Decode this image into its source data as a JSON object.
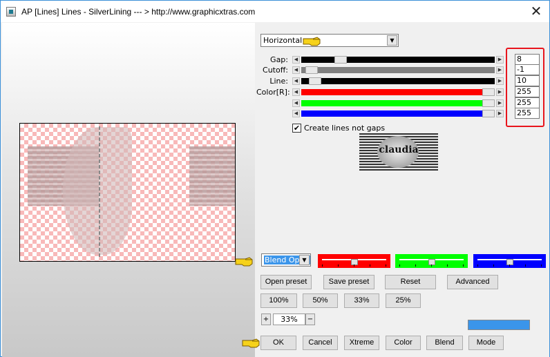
{
  "window": {
    "title": "AP [Lines]  Lines - SilverLining    --- > http://www.graphicxtras.com",
    "close_glyph": "✕"
  },
  "direction": {
    "value": "Horizontal",
    "arrow_glyph": "▼"
  },
  "sliders": [
    {
      "label": "Gap:",
      "value": "8",
      "color": "#000000",
      "fraction": 0.17
    },
    {
      "label": "Cutoff:",
      "value": "-1",
      "color": "#808080",
      "fraction": 0.02
    },
    {
      "label": "Line:",
      "value": "10",
      "color": "#000000",
      "fraction": 0.04
    },
    {
      "label": "Color[R]:",
      "value": "255",
      "color": "#ff0000",
      "fraction": 1.0
    },
    {
      "label": "",
      "value": "255",
      "color": "#00ff00",
      "fraction": 1.0
    },
    {
      "label": "",
      "value": "255",
      "color": "#0000ff",
      "fraction": 1.0
    }
  ],
  "checkbox": {
    "label": "Create lines not gaps",
    "checked": true,
    "mark": "✔"
  },
  "logo": {
    "text": "claudia"
  },
  "blend_select": {
    "value": "Blend Optio",
    "arrow_glyph": "▼"
  },
  "color_bars": [
    {
      "color": "#ff0000",
      "fraction": 0.5
    },
    {
      "color": "#00ff00",
      "fraction": 0.5
    },
    {
      "color": "#0000ff",
      "fraction": 0.5
    }
  ],
  "buttons_row1": [
    "Open preset",
    "Save preset",
    "Reset",
    "Advanced"
  ],
  "zoom_presets": [
    "100%",
    "50%",
    "33%",
    "25%"
  ],
  "zoom": {
    "plus": "+",
    "minus": "−",
    "value": "33%"
  },
  "bottom_buttons": [
    "OK",
    "Cancel",
    "Xtreme",
    "Color",
    "Blend",
    "Mode"
  ],
  "accent_color": "#3b95ea",
  "highlight_color": "#e8141c"
}
